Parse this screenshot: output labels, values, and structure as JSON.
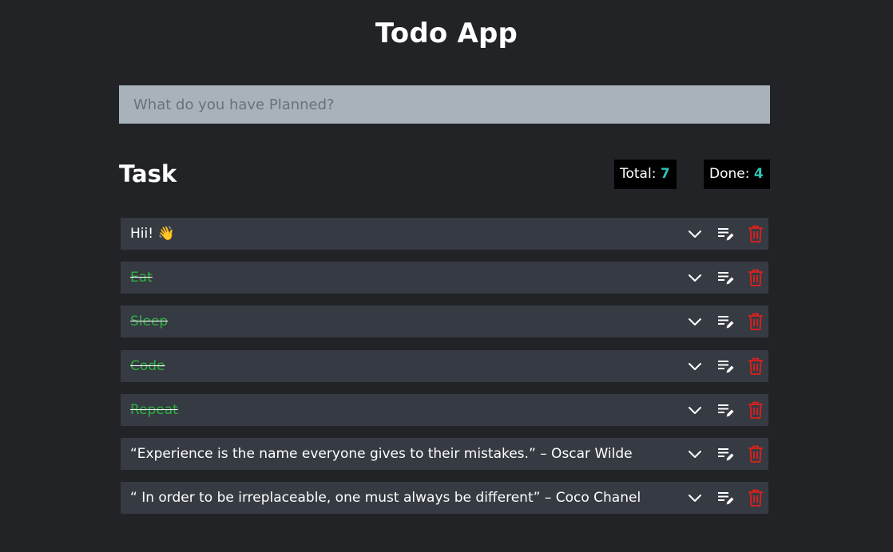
{
  "app": {
    "title": "Todo App"
  },
  "input": {
    "placeholder": "What do you have Planned?"
  },
  "tasks_section": {
    "title": "Task",
    "total_label": "Total:",
    "total_count": "7",
    "done_label": "Done:",
    "done_count": "4"
  },
  "tasks": [
    {
      "text": "Hii! 👋",
      "done": false
    },
    {
      "text": "Eat",
      "done": true
    },
    {
      "text": "Sleep",
      "done": true
    },
    {
      "text": "Code",
      "done": true
    },
    {
      "text": "Repeat",
      "done": true
    },
    {
      "text": "“Experience is the name everyone gives to their mistakes.” – Oscar Wilde",
      "done": false
    },
    {
      "text": "“ In order to be irreplaceable, one must always be different” – Coco Chanel",
      "done": false
    }
  ],
  "icons": {
    "expand": "chevron-down-icon",
    "edit": "edit-list-icon",
    "delete": "trash-icon"
  },
  "colors": {
    "background": "#212327",
    "input_background": "#a8b2bb",
    "task_background": "#363a42",
    "counter_background": "#000000",
    "count_accent": "#2ec4b6",
    "done_text": "#2fb142",
    "delete_icon": "#e0201c"
  }
}
